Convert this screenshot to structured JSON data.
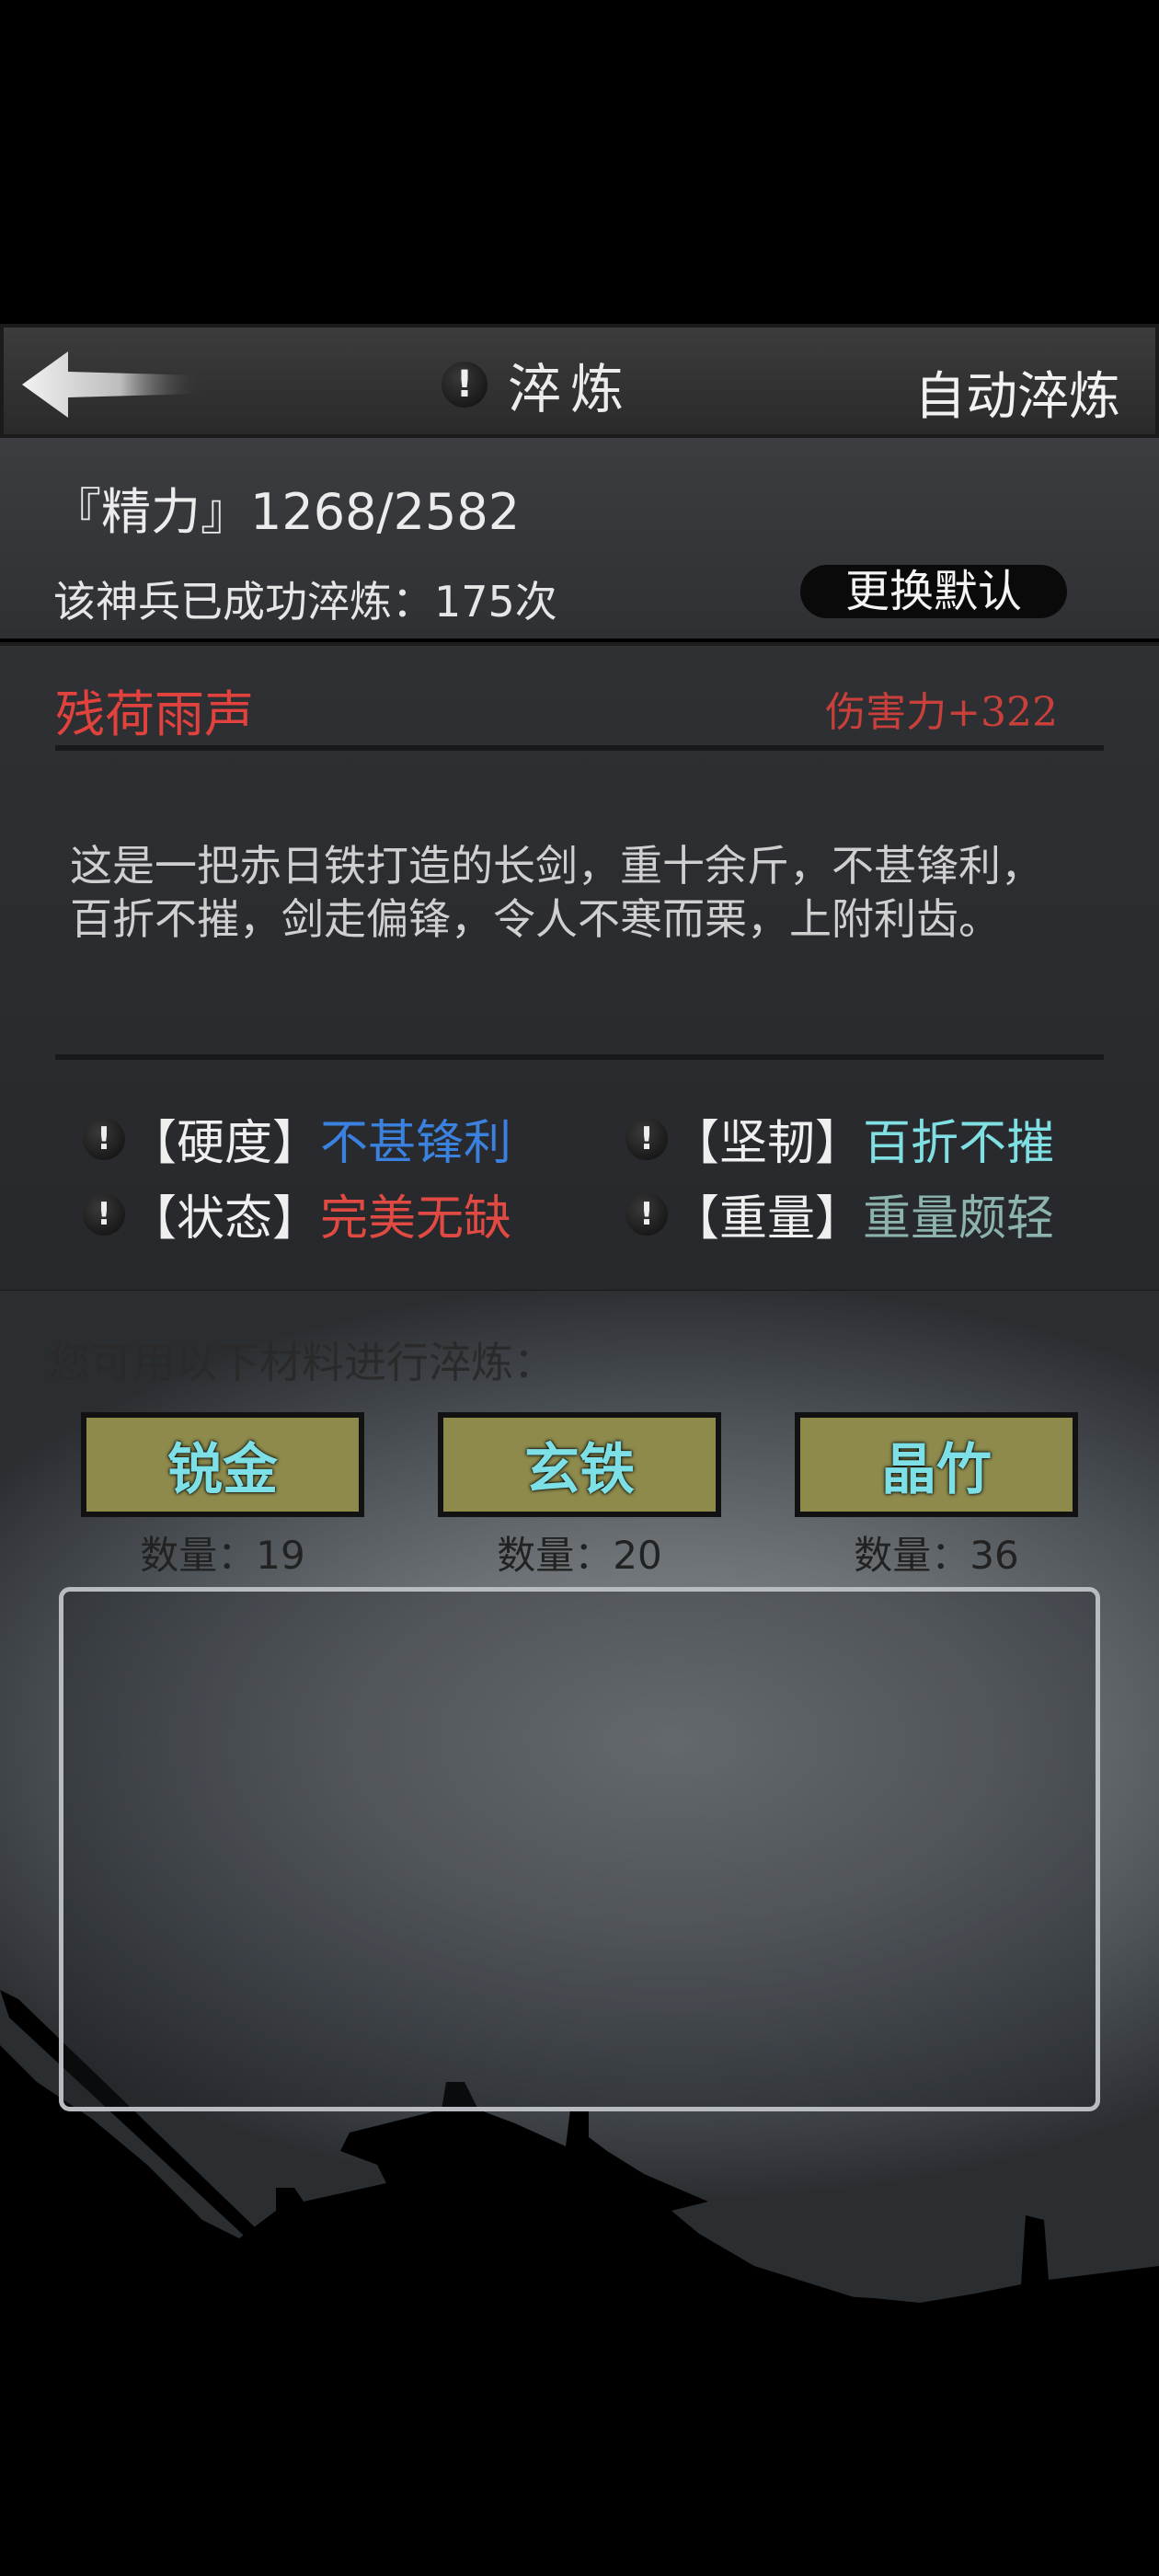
{
  "header": {
    "title": "淬炼",
    "info_glyph": "!",
    "auto_button": "自动淬炼",
    "back_icon": "back-arrow-icon"
  },
  "stats": {
    "energy": "『精力』1268/2582",
    "refine_count": "该神兵已成功淬炼：175次",
    "change_default": "更换默认"
  },
  "weapon": {
    "name": "残荷雨声",
    "damage": "伤害力+322",
    "description_line1": "这是一把赤日铁打造的长剑，重十余斤，不甚锋利，",
    "description_line2": "百折不摧，剑走偏锋，令人不寒而栗，上附利齿。",
    "attributes": [
      {
        "label": "【硬度】",
        "value": "不甚锋利",
        "color": "#3b82e0"
      },
      {
        "label": "【坚韧】",
        "value": "百折不摧",
        "color": "#7fdfe2"
      },
      {
        "label": "【状态】",
        "value": "完美无缺",
        "color": "#e04a42"
      },
      {
        "label": "【重量】",
        "value": "重量颇轻",
        "color": "#8cb3ad"
      }
    ]
  },
  "materials": {
    "label": "您可用以下材料进行淬炼：",
    "items": [
      {
        "name": "锐金",
        "qty": "数量：19"
      },
      {
        "name": "玄铁",
        "qty": "数量：20"
      },
      {
        "name": "晶竹",
        "qty": "数量：36"
      }
    ]
  },
  "colors": {
    "accent_red": "#e2423d",
    "material_button": "#8d8a4c",
    "material_text": "#7de0e6"
  }
}
